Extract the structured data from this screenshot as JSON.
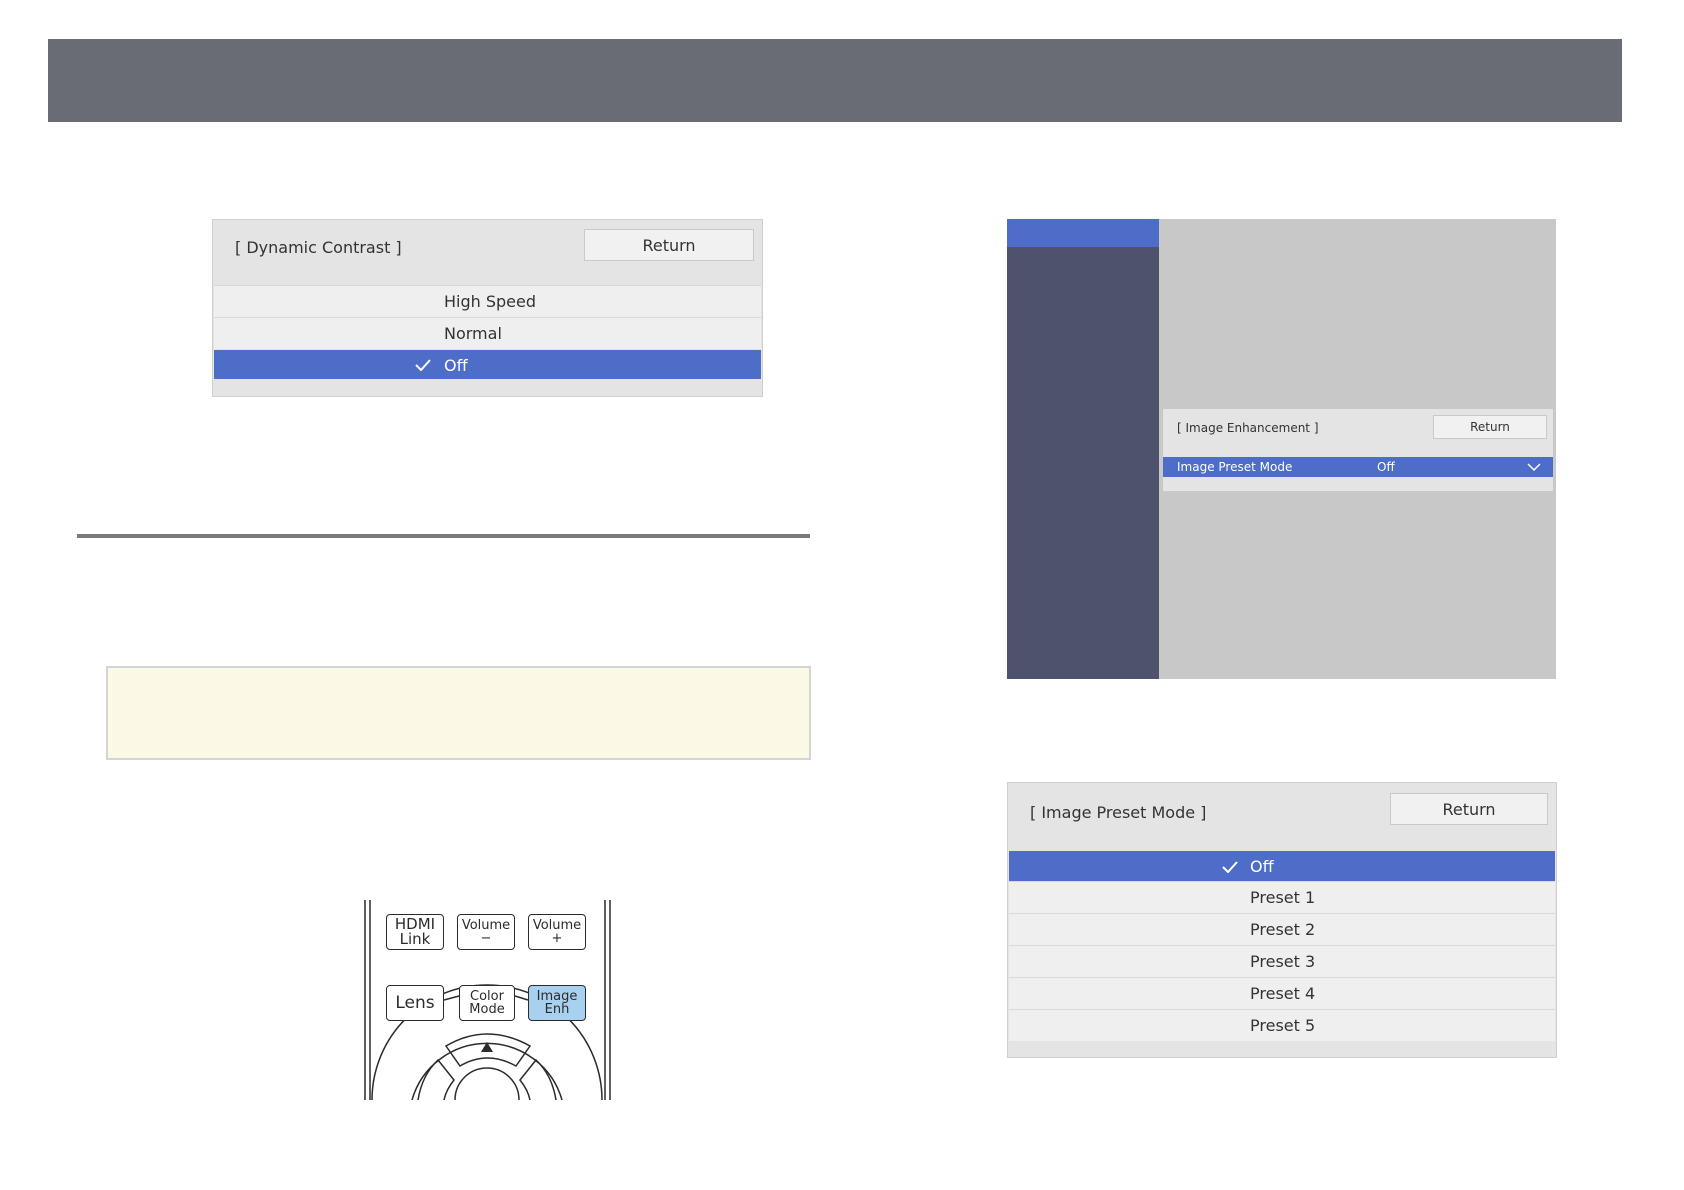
{
  "header": {
    "color": "#696c75"
  },
  "dynamic_contrast_menu": {
    "title": "[ Dynamic Contrast ]",
    "return_label": "Return",
    "options": [
      {
        "label": "High Speed",
        "selected": false
      },
      {
        "label": "Normal",
        "selected": false
      },
      {
        "label": "Off",
        "selected": true
      }
    ]
  },
  "image_enhancement_menu": {
    "title": "[ Image Enhancement ]",
    "return_label": "Return",
    "row_label": "Image Preset Mode",
    "row_value": "Off"
  },
  "image_preset_menu": {
    "title": "[ Image Preset Mode ]",
    "return_label": "Return",
    "options": [
      {
        "label": "Off",
        "selected": true
      },
      {
        "label": "Preset 1",
        "selected": false
      },
      {
        "label": "Preset 2",
        "selected": false
      },
      {
        "label": "Preset 3",
        "selected": false
      },
      {
        "label": "Preset 4",
        "selected": false
      },
      {
        "label": "Preset 5",
        "selected": false
      }
    ]
  },
  "remote": {
    "keys": {
      "hdmi_link": [
        "HDMI",
        "Link"
      ],
      "volume_down": [
        "Volume",
        "−"
      ],
      "volume_up": [
        "Volume",
        "+"
      ],
      "lens": [
        "Lens"
      ],
      "color_mode": [
        "Color",
        "Mode"
      ],
      "image_enh": [
        "Image",
        "Enh"
      ]
    },
    "highlight_color": "#a8d0ef"
  },
  "accent_color": "#4d6dc8"
}
